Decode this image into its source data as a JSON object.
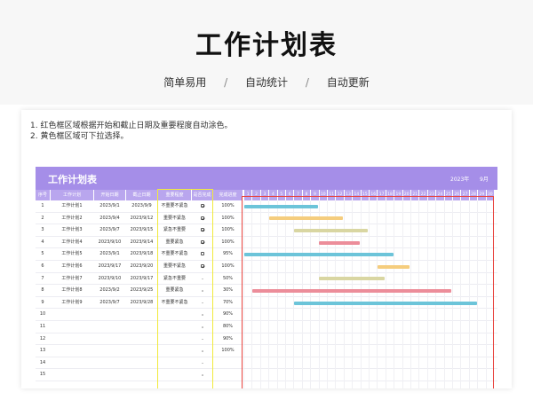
{
  "header": {
    "title": "工作计划表",
    "tabs": [
      "简单易用",
      "自动统计",
      "自动更新"
    ],
    "separator": "/"
  },
  "notes": [
    "1. 红色框区域根据开始和截止日期及重要程度自动涂色。",
    "2. 黄色框区域可下拉选择。"
  ],
  "sheet": {
    "title": "工作计划表",
    "year": "2023年",
    "month": "9月",
    "columns": [
      "序号",
      "工作计划",
      "开始日期",
      "截止日期",
      "重要程度",
      "是否完成",
      "完成进度"
    ],
    "days": [
      "1",
      "2",
      "3",
      "4",
      "5",
      "6",
      "7",
      "8",
      "9",
      "10",
      "11",
      "12",
      "13",
      "14",
      "15",
      "16",
      "17",
      "18",
      "19",
      "20",
      "21",
      "22",
      "23",
      "24",
      "25",
      "26",
      "27",
      "28",
      "29",
      "30"
    ],
    "rows": [
      {
        "no": "1",
        "task": "工作计划1",
        "start": "2023/9/1",
        "end": "2023/9/9",
        "priority": "不重要不紧急",
        "done": "checked",
        "progress": "100%",
        "bar_start": 1,
        "bar_end": 9,
        "bar_color": "#6cc4d9"
      },
      {
        "no": "2",
        "task": "工作计划2",
        "start": "2023/9/4",
        "end": "2023/9/12",
        "priority": "重要不紧急",
        "done": "checked",
        "progress": "100%",
        "bar_start": 4,
        "bar_end": 12,
        "bar_color": "#f5cd7e"
      },
      {
        "no": "3",
        "task": "工作计划3",
        "start": "2023/9/7",
        "end": "2023/9/15",
        "priority": "紧急不重要",
        "done": "checked",
        "progress": "100%",
        "bar_start": 7,
        "bar_end": 15,
        "bar_color": "#d9d6a2"
      },
      {
        "no": "4",
        "task": "工作计划4",
        "start": "2023/9/10",
        "end": "2023/9/14",
        "priority": "重要紧急",
        "done": "checked",
        "progress": "100%",
        "bar_start": 10,
        "bar_end": 14,
        "bar_color": "#ec8d9a"
      },
      {
        "no": "5",
        "task": "工作计划5",
        "start": "2023/9/1",
        "end": "2023/9/18",
        "priority": "不重要不紧急",
        "done": "unchecked",
        "progress": "95%",
        "bar_start": 1,
        "bar_end": 18,
        "bar_color": "#6cc4d9"
      },
      {
        "no": "6",
        "task": "工作计划6",
        "start": "2023/9/17",
        "end": "2023/9/20",
        "priority": "重要不紧急",
        "done": "checked",
        "progress": "100%",
        "bar_start": 17,
        "bar_end": 20,
        "bar_color": "#f5cd7e"
      },
      {
        "no": "7",
        "task": "工作计划7",
        "start": "2023/9/10",
        "end": "2023/9/17",
        "priority": "紧急不重要",
        "done": "none",
        "progress": "50%",
        "bar_start": 10,
        "bar_end": 17,
        "bar_color": "#d9d6a2"
      },
      {
        "no": "8",
        "task": "工作计划8",
        "start": "2023/9/2",
        "end": "2023/9/25",
        "priority": "重要紧急",
        "done": "none",
        "progress": "30%",
        "bar_start": 2,
        "bar_end": 25,
        "bar_color": "#ec8d9a"
      },
      {
        "no": "9",
        "task": "工作计划9",
        "start": "2023/9/7",
        "end": "2023/9/28",
        "priority": "不重要不紧急",
        "done": "none",
        "progress": "70%",
        "bar_start": 7,
        "bar_end": 28,
        "bar_color": "#6cc4d9"
      },
      {
        "no": "10",
        "task": "",
        "start": "",
        "end": "",
        "priority": "",
        "done": "none",
        "progress": "90%"
      },
      {
        "no": "11",
        "task": "",
        "start": "",
        "end": "",
        "priority": "",
        "done": "none",
        "progress": "80%"
      },
      {
        "no": "12",
        "task": "",
        "start": "",
        "end": "",
        "priority": "",
        "done": "none",
        "progress": "90%"
      },
      {
        "no": "13",
        "task": "",
        "start": "",
        "end": "",
        "priority": "",
        "done": "none",
        "progress": "100%"
      },
      {
        "no": "14",
        "task": "",
        "start": "",
        "end": "",
        "priority": "",
        "done": "none",
        "progress": ""
      },
      {
        "no": "15",
        "task": "",
        "start": "",
        "end": "",
        "priority": "",
        "done": "none",
        "progress": ""
      }
    ]
  }
}
